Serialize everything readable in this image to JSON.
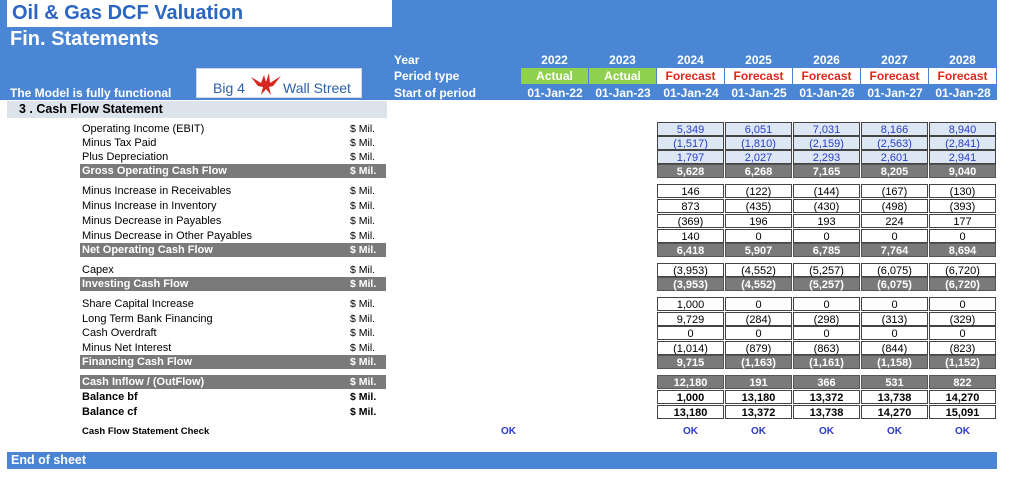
{
  "header": {
    "title": "Oil & Gas DCF Valuation",
    "subtitle": "Fin. Statements",
    "status": "The Model is fully functional",
    "logo_left": "Big 4",
    "logo_right": "Wall Street",
    "labels": {
      "year": "Year",
      "period_type": "Period type",
      "start": "Start of period"
    }
  },
  "years": [
    "2022",
    "2023",
    "2024",
    "2025",
    "2026",
    "2027",
    "2028"
  ],
  "period_types": [
    "Actual",
    "Actual",
    "Forecast",
    "Forecast",
    "Forecast",
    "Forecast",
    "Forecast"
  ],
  "dates": [
    "01-Jan-22",
    "01-Jan-23",
    "01-Jan-24",
    "01-Jan-25",
    "01-Jan-26",
    "01-Jan-27",
    "01-Jan-28"
  ],
  "section_title": "3 . Cash Flow Statement",
  "rows": [
    {
      "label": "Operating Income (EBIT)",
      "unit": "$ Mil.",
      "values": [
        "5,349",
        "6,051",
        "7,031",
        "8,166",
        "8,940"
      ]
    },
    {
      "label": "Minus Tax Paid",
      "unit": "$ Mil.",
      "values": [
        "(1,517)",
        "(1,810)",
        "(2,159)",
        "(2,563)",
        "(2,841)"
      ]
    },
    {
      "label": "Plus Depreciation",
      "unit": "$ Mil.",
      "values": [
        "1,797",
        "2,027",
        "2,293",
        "2,601",
        "2,941"
      ]
    },
    {
      "label": "Gross Operating Cash Flow",
      "unit": "$ Mil.",
      "values": [
        "5,628",
        "6,268",
        "7,165",
        "8,205",
        "9,040"
      ]
    },
    {
      "label": "Minus Increase in Receivables",
      "unit": "$ Mil.",
      "values": [
        "146",
        "(122)",
        "(144)",
        "(167)",
        "(130)"
      ]
    },
    {
      "label": "Minus Increase in Inventory",
      "unit": "$ Mil.",
      "values": [
        "873",
        "(435)",
        "(430)",
        "(498)",
        "(393)"
      ]
    },
    {
      "label": "Minus Decrease in Payables",
      "unit": "$ Mil.",
      "values": [
        "(369)",
        "196",
        "193",
        "224",
        "177"
      ]
    },
    {
      "label": "Minus Decrease in Other Payables",
      "unit": "$ Mil.",
      "values": [
        "140",
        "0",
        "0",
        "0",
        "0"
      ]
    },
    {
      "label": "Net Operating Cash Flow",
      "unit": "$ Mil.",
      "values": [
        "6,418",
        "5,907",
        "6,785",
        "7,764",
        "8,694"
      ]
    },
    {
      "label": "Capex",
      "unit": "$ Mil.",
      "values": [
        "(3,953)",
        "(4,552)",
        "(5,257)",
        "(6,075)",
        "(6,720)"
      ]
    },
    {
      "label": "Investing Cash Flow",
      "unit": "$ Mil.",
      "values": [
        "(3,953)",
        "(4,552)",
        "(5,257)",
        "(6,075)",
        "(6,720)"
      ]
    },
    {
      "label": "Share Capital Increase",
      "unit": "$ Mil.",
      "values": [
        "1,000",
        "0",
        "0",
        "0",
        "0"
      ]
    },
    {
      "label": "Long Term Bank Financing",
      "unit": "$ Mil.",
      "values": [
        "9,729",
        "(284)",
        "(298)",
        "(313)",
        "(329)"
      ]
    },
    {
      "label": "Cash Overdraft",
      "unit": "$ Mil.",
      "values": [
        "0",
        "0",
        "0",
        "0",
        "0"
      ]
    },
    {
      "label": "Minus Net Interest",
      "unit": "$ Mil.",
      "values": [
        "(1,014)",
        "(879)",
        "(863)",
        "(844)",
        "(823)"
      ]
    },
    {
      "label": "Financing Cash Flow",
      "unit": "$ Mil.",
      "values": [
        "9,715",
        "(1,163)",
        "(1,161)",
        "(1,158)",
        "(1,152)"
      ]
    },
    {
      "label": "Cash Inflow / (OutFlow)",
      "unit": "$ Mil.",
      "values": [
        "12,180",
        "191",
        "366",
        "531",
        "822"
      ]
    },
    {
      "label": "Balance bf",
      "unit": "$ Mil.",
      "values": [
        "1,000",
        "13,180",
        "13,372",
        "13,738",
        "14,270"
      ]
    },
    {
      "label": "Balance cf",
      "unit": "$ Mil.",
      "values": [
        "13,180",
        "13,372",
        "13,738",
        "14,270",
        "15,091"
      ]
    }
  ],
  "check": {
    "label": "Cash Flow Statement Check",
    "overall": "OK",
    "values": [
      "OK",
      "OK",
      "OK",
      "OK",
      "OK"
    ]
  },
  "footer": "End of sheet",
  "colors": {
    "header_bg": "#4a86d4",
    "actual": "#8fd14f",
    "forecast_text": "#e0271c",
    "input_blue": "#2a3fc8",
    "total_bg": "#7a7a7a"
  }
}
